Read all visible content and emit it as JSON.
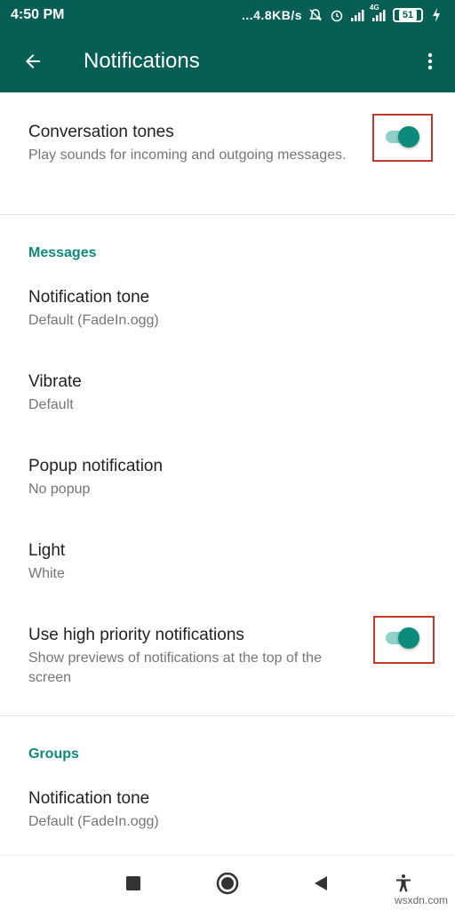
{
  "status_bar": {
    "time": "4:50 PM",
    "net_speed": "...4.8KB/s",
    "network_label": "4G",
    "battery_level": "51",
    "icons": [
      "mute-icon",
      "alarm-icon",
      "signal-icon",
      "signal-4g-icon",
      "battery-icon",
      "charging-icon"
    ]
  },
  "app_bar": {
    "title": "Notifications",
    "back_icon": "arrow-back-icon",
    "menu_icon": "more-vert-icon"
  },
  "settings": {
    "conversation_tones": {
      "title": "Conversation tones",
      "subtitle": "Play sounds for incoming and outgoing messages.",
      "enabled": true
    },
    "messages": {
      "header": "Messages",
      "notification_tone": {
        "title": "Notification tone",
        "value": "Default (FadeIn.ogg)"
      },
      "vibrate": {
        "title": "Vibrate",
        "value": "Default"
      },
      "popup": {
        "title": "Popup notification",
        "value": "No popup"
      },
      "light": {
        "title": "Light",
        "value": "White"
      },
      "high_priority": {
        "title": "Use high priority notifications",
        "subtitle": "Show previews of notifications at the top of the screen",
        "enabled": true
      }
    },
    "groups": {
      "header": "Groups",
      "notification_tone": {
        "title": "Notification tone",
        "value": "Default (FadeIn.ogg)"
      }
    }
  },
  "nav_bar": {
    "icons": [
      "recents-square-icon",
      "home-circle-icon",
      "back-triangle-icon",
      "accessibility-icon"
    ]
  },
  "watermark": "wsxdn.com",
  "colors": {
    "primary": "#075e54",
    "accent": "#0c8b7c",
    "highlight": "#c0392b"
  }
}
